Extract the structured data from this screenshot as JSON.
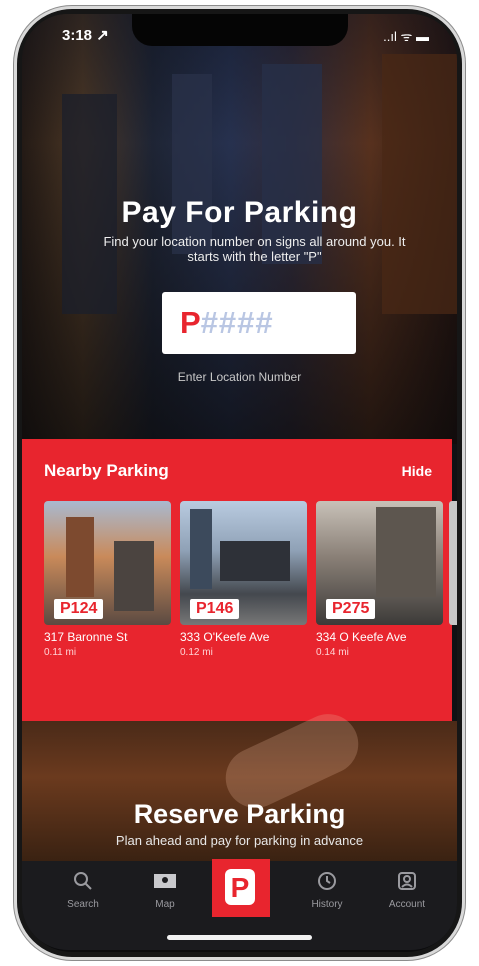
{
  "status": {
    "time": "3:18 ↗",
    "icons": "..ıl ᯤ ▬"
  },
  "hero": {
    "title": "Pay For Parking",
    "subtitle": "Find your location number on signs all around you. It starts with the letter \"P\"",
    "input_prefix": "P",
    "input_placeholder": "####",
    "input_label": "Enter Location Number"
  },
  "nearby": {
    "title": "Nearby Parking",
    "hide_label": "Hide",
    "lots": [
      {
        "code": "P124",
        "address": "317 Baronne St",
        "distance": "0.11 mi"
      },
      {
        "code": "P146",
        "address": "333 O'Keefe Ave",
        "distance": "0.12 mi"
      },
      {
        "code": "P275",
        "address": "334 O Keefe Ave",
        "distance": "0.14 mi"
      }
    ]
  },
  "reserve": {
    "title": "Reserve Parking",
    "subtitle": "Plan ahead and pay for parking in advance"
  },
  "tabs": [
    {
      "label": "Search",
      "icon": "search-icon"
    },
    {
      "label": "Map",
      "icon": "map-icon"
    },
    {
      "label": "",
      "icon": "parking-logo-icon"
    },
    {
      "label": "History",
      "icon": "history-icon"
    },
    {
      "label": "Account",
      "icon": "account-icon"
    }
  ],
  "colors": {
    "accent": "#e8252e",
    "tabbar": "#1b1b1e"
  }
}
